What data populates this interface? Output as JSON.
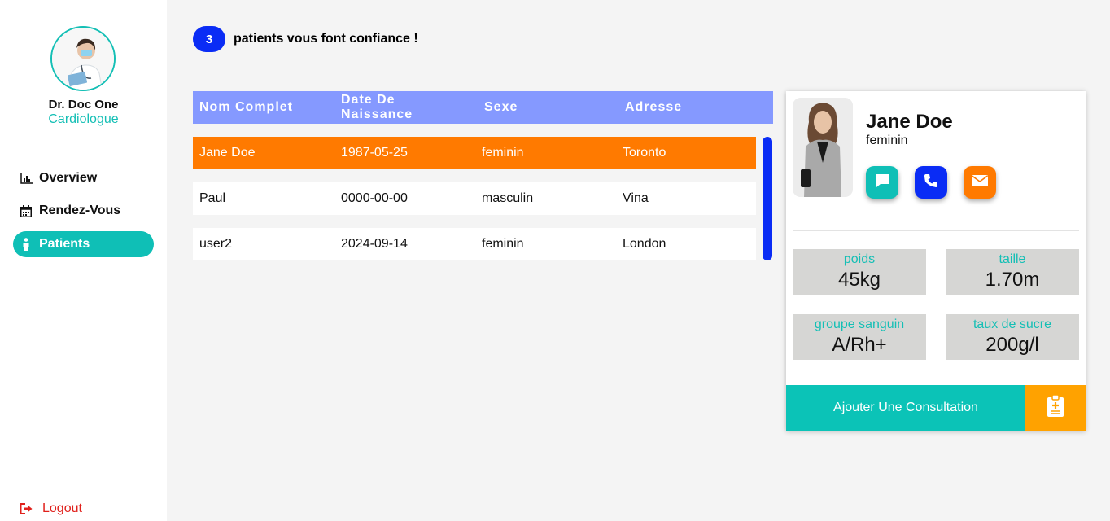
{
  "doctor": {
    "name": "Dr. Doc One",
    "specialty": "Cardiologue"
  },
  "nav": {
    "items": [
      {
        "label": "Overview",
        "icon": "bar-chart-icon"
      },
      {
        "label": "Rendez-Vous",
        "icon": "calendar-icon"
      },
      {
        "label": "Patients",
        "icon": "person-icon"
      }
    ],
    "active": "Patients",
    "logout_label": "Logout"
  },
  "summary": {
    "count": "3",
    "text": "patients vous font confiance !"
  },
  "table": {
    "headers": [
      "Nom Complet",
      "Date De Naissance",
      "Sexe",
      "Adresse"
    ],
    "rows": [
      {
        "name": "Jane Doe",
        "birth": "1987-05-25",
        "sex": "feminin",
        "address": "Toronto"
      },
      {
        "name": "Paul",
        "birth": "0000-00-00",
        "sex": "masculin",
        "address": "Vina"
      },
      {
        "name": "user2",
        "birth": "2024-09-14",
        "sex": "feminin",
        "address": "London"
      }
    ]
  },
  "patient": {
    "name": "Jane Doe",
    "sex": "feminin",
    "stats": [
      {
        "label": "poids",
        "value": "45kg"
      },
      {
        "label": "taille",
        "value": "1.70m"
      },
      {
        "label": "groupe sanguin",
        "value": "A/Rh+"
      },
      {
        "label": "taux de sucre",
        "value": "200g/l"
      }
    ],
    "add_consultation_label": "Ajouter Une Consultation"
  },
  "colors": {
    "accent_teal": "#0fbfb6",
    "accent_blue": "#0a2cf5",
    "accent_orange": "#ff7a00",
    "header_blue": "#8599ff",
    "amber": "#ffa200",
    "logout_red": "#e0201b"
  }
}
